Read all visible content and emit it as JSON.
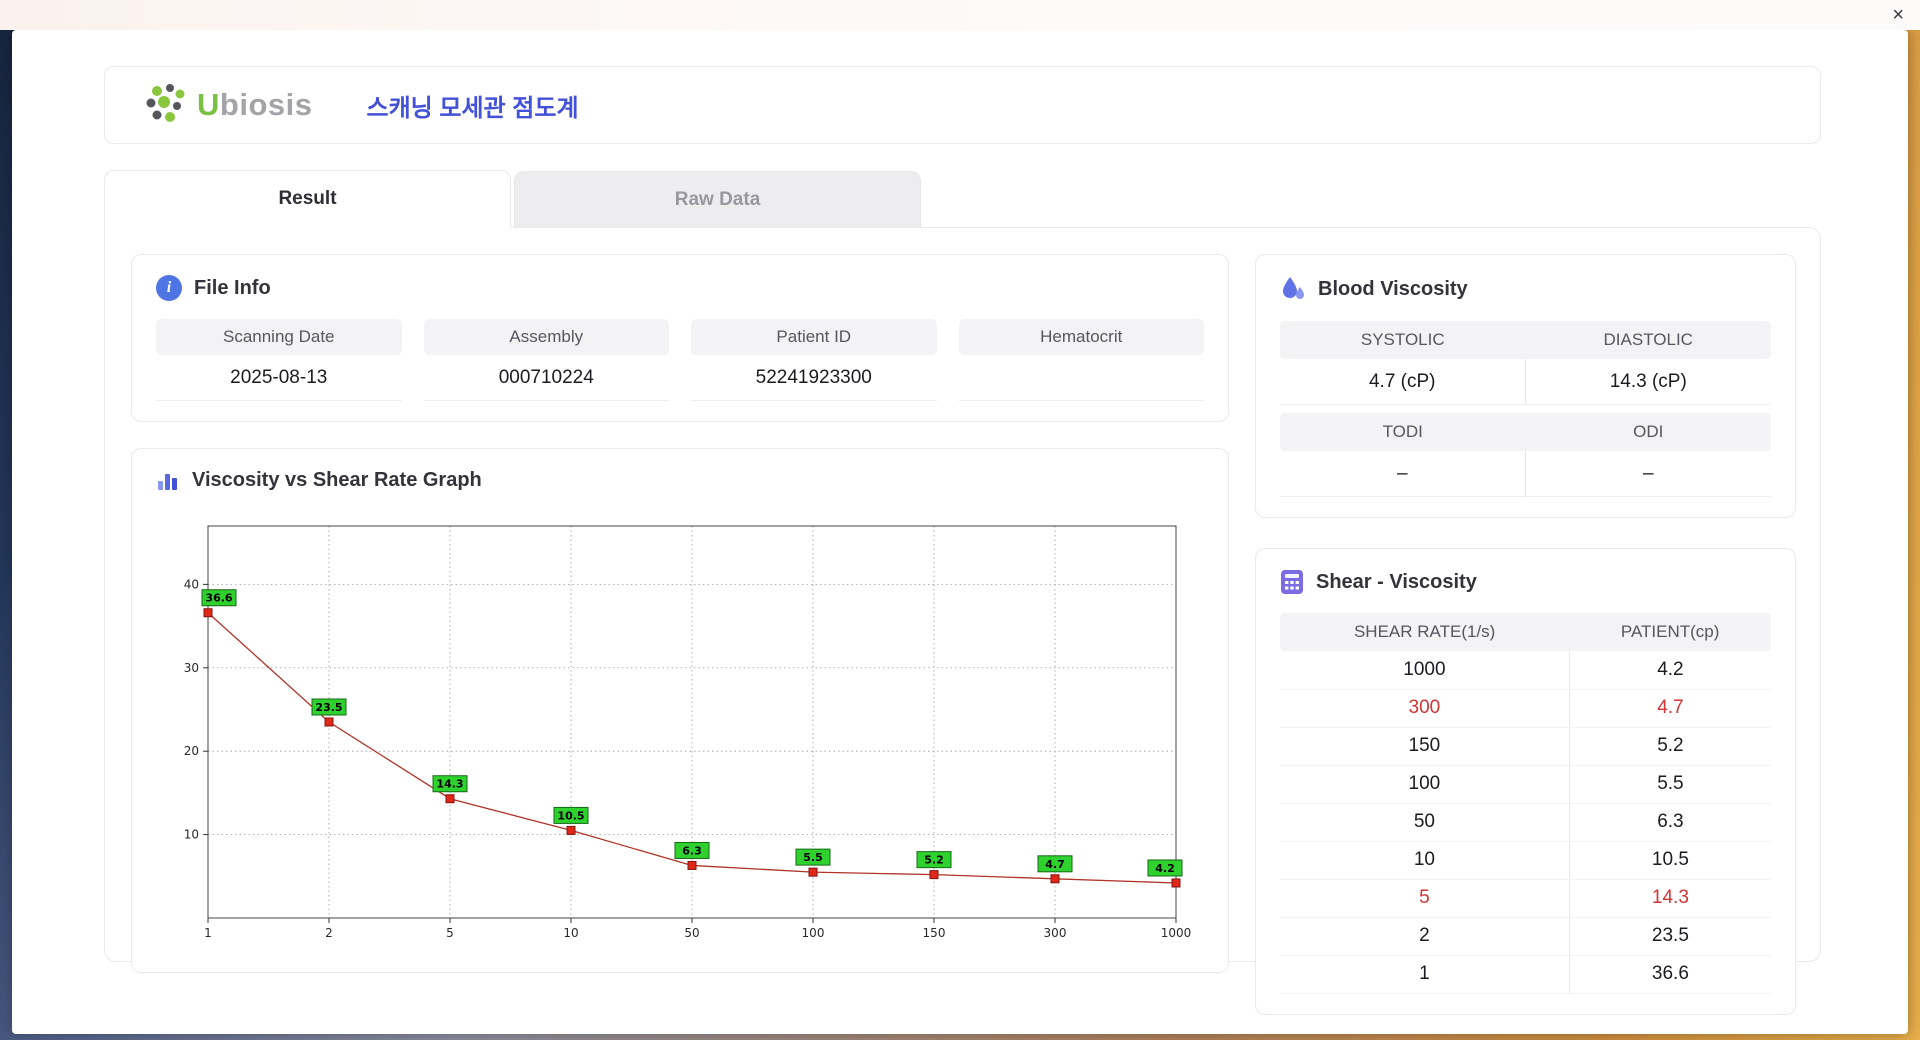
{
  "window": {
    "close_label": "×"
  },
  "brand": {
    "name_accent": "U",
    "name_rest": "biosis",
    "app_title": "스캐닝 모세관 점도계"
  },
  "icons": {
    "info_glyph": "i"
  },
  "tabs": {
    "result": "Result",
    "raw_data": "Raw Data"
  },
  "file_info": {
    "title": "File Info",
    "fields": [
      {
        "label": "Scanning Date",
        "value": "2025-08-13"
      },
      {
        "label": "Assembly",
        "value": "000710224"
      },
      {
        "label": "Patient ID",
        "value": "52241923300"
      },
      {
        "label": "Hematocrit",
        "value": ""
      }
    ]
  },
  "blood_viscosity": {
    "title": "Blood Viscosity",
    "systolic_label": "SYSTOLIC",
    "systolic_value": "4.7 (cP)",
    "diastolic_label": "DIASTOLIC",
    "diastolic_value": "14.3 (cP)",
    "todi_label": "TODI",
    "todi_value": "–",
    "odi_label": "ODI",
    "odi_value": "–"
  },
  "shear_viscosity": {
    "title": "Shear - Viscosity",
    "columns": [
      "SHEAR RATE(1/s)",
      "PATIENT(cp)"
    ],
    "rows": [
      {
        "shear_rate": "1000",
        "patient": "4.2",
        "highlight": false
      },
      {
        "shear_rate": "300",
        "patient": "4.7",
        "highlight": true
      },
      {
        "shear_rate": "150",
        "patient": "5.2",
        "highlight": false
      },
      {
        "shear_rate": "100",
        "patient": "5.5",
        "highlight": false
      },
      {
        "shear_rate": "50",
        "patient": "6.3",
        "highlight": false
      },
      {
        "shear_rate": "10",
        "patient": "10.5",
        "highlight": false
      },
      {
        "shear_rate": "5",
        "patient": "14.3",
        "highlight": true
      },
      {
        "shear_rate": "2",
        "patient": "23.5",
        "highlight": false
      },
      {
        "shear_rate": "1",
        "patient": "36.6",
        "highlight": false
      }
    ]
  },
  "graph": {
    "title": "Viscosity vs Shear Rate Graph"
  },
  "chart_data": {
    "type": "line",
    "title": "Viscosity vs Shear Rate Graph",
    "xlabel": "",
    "ylabel": "",
    "x_scale": "ordinal",
    "x": [
      1,
      2,
      5,
      10,
      50,
      100,
      150,
      300,
      1000
    ],
    "y": [
      36.6,
      23.5,
      14.3,
      10.5,
      6.3,
      5.5,
      5.2,
      4.7,
      4.2
    ],
    "x_tick_labels": [
      "1",
      "2",
      "5",
      "10",
      "50",
      "100",
      "150",
      "300",
      "1000"
    ],
    "y_ticks": [
      10,
      20,
      30,
      40
    ],
    "ylim": [
      0,
      47
    ],
    "grid": true,
    "legend": "none",
    "colors": {
      "line": "#b03328",
      "marker": "#e02718",
      "marker_border": "#801410",
      "label_bg": "#2fd12f",
      "label_border": "#156b15",
      "label_text": "#000000"
    }
  },
  "colors": {
    "accent_blue": "#4350d8",
    "brand_green": "#7ac143",
    "highlight_red": "#d03434"
  }
}
